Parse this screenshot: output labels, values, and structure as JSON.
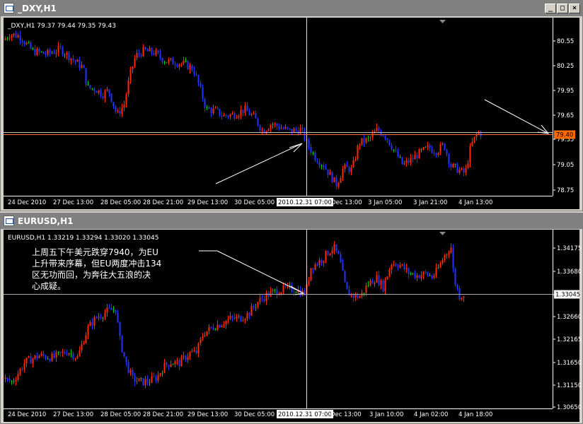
{
  "windows": [
    {
      "title": "_DXY,H1",
      "header": "_DXY,H1  79.37 79.44 79.35 79.43",
      "price_tag": "79.40",
      "bid_line": 79.42,
      "prices": [
        "80.55",
        "80.25",
        "79.95",
        "79.65",
        "79.35",
        "79.05",
        "78.75"
      ],
      "times": [
        "24 Dec 2010",
        "27 Dec 13:00",
        "28 Dec 05:00",
        "28 Dec 21:00",
        "29 Dec 13:00",
        "30 Dec 05:00",
        "2010.12.31 07:00",
        "Dec 13:00",
        "3 Jan 05:00",
        "3 Jan 21:00",
        "4 Jan 13:00"
      ],
      "ylim": [
        78.72,
        80.75
      ]
    },
    {
      "title": "EURUSD,H1",
      "header": "EURUSD,H1  1.33219 1.33294 1.33020 1.33045",
      "price_tag": "1.33045",
      "bid_line": 1.33045,
      "prices": [
        "1.34175",
        "1.33680",
        "1.33170",
        "1.32660",
        "1.32165",
        "1.31650",
        "1.31150",
        "1.30650"
      ],
      "times": [
        "24 Dec 2010",
        "27 Dec 13:00",
        "28 Dec 05:00",
        "28 Dec 21:00",
        "29 Dec 13:00",
        "30 Dec 05:00",
        "2010.12.31 07:00",
        "Dec 13:00",
        "3 Jan 10:00",
        "4 Jan 02:00",
        "4 Jan 18:00"
      ],
      "ylim": [
        1.305,
        1.344
      ],
      "annotation": [
        "上周五下午美元跌穿7940，为EU",
        "上升带来序幕，但EU两度冲击134",
        "区无功而回，为奔往大五浪的决",
        "心成疑。"
      ]
    }
  ],
  "buttons": {
    "minimize": "_",
    "maximize": "□",
    "close": "×"
  },
  "colors": {
    "up": "#ff2a00",
    "down": "#2233ff",
    "doji": "#00cc00",
    "bid": "#ff6a3d",
    "grid_line": "#aaaaaa",
    "tag_bg": "#ff6a00"
  }
}
